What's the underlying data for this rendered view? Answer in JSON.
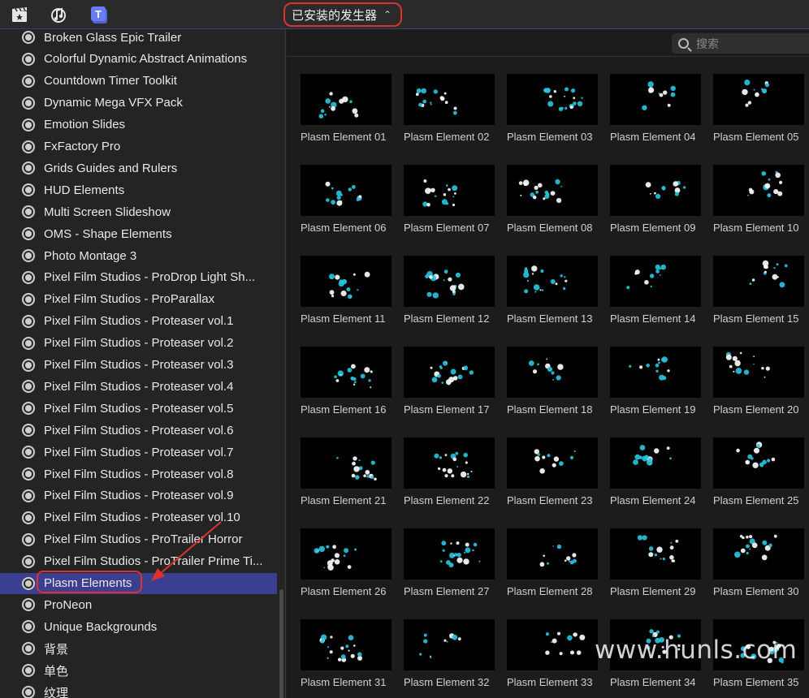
{
  "toolbar": {
    "icons": [
      "clapper-star-icon",
      "music-cam-icon",
      "titles-icon"
    ],
    "selector_label": "已安装的发生器",
    "selector_chevron": "⌃⌄"
  },
  "search": {
    "placeholder": "搜索"
  },
  "sidebar": {
    "items": [
      {
        "label": "Broken Glass Epic Trailer"
      },
      {
        "label": "Colorful Dynamic Abstract Animations"
      },
      {
        "label": "Countdown Timer Toolkit"
      },
      {
        "label": "Dynamic Mega VFX Pack"
      },
      {
        "label": "Emotion Slides"
      },
      {
        "label": "FxFactory Pro"
      },
      {
        "label": "Grids Guides and Rulers"
      },
      {
        "label": "HUD Elements"
      },
      {
        "label": "Multi Screen Slideshow"
      },
      {
        "label": "OMS - Shape Elements"
      },
      {
        "label": "Photo Montage 3"
      },
      {
        "label": "Pixel Film Studios - ProDrop Light Sh..."
      },
      {
        "label": "Pixel Film Studios - ProParallax"
      },
      {
        "label": "Pixel Film Studios - Proteaser vol.1"
      },
      {
        "label": "Pixel Film Studios - Proteaser vol.2"
      },
      {
        "label": "Pixel Film Studios - Proteaser vol.3"
      },
      {
        "label": "Pixel Film Studios - Proteaser vol.4"
      },
      {
        "label": "Pixel Film Studios - Proteaser vol.5"
      },
      {
        "label": "Pixel Film Studios - Proteaser vol.6"
      },
      {
        "label": "Pixel Film Studios - Proteaser vol.7"
      },
      {
        "label": "Pixel Film Studios - Proteaser vol.8"
      },
      {
        "label": "Pixel Film Studios - Proteaser vol.9"
      },
      {
        "label": "Pixel Film Studios - Proteaser vol.10"
      },
      {
        "label": "Pixel Film Studios - ProTrailer Horror"
      },
      {
        "label": "Pixel Film Studios - ProTrailer Prime Ti..."
      },
      {
        "label": "Plasm Elements",
        "selected": true
      },
      {
        "label": "ProNeon"
      },
      {
        "label": "Unique Backgrounds"
      },
      {
        "label": "背景"
      },
      {
        "label": "单色"
      },
      {
        "label": "纹理"
      }
    ]
  },
  "grid": {
    "items": [
      "Plasm Element 01",
      "Plasm Element 02",
      "Plasm Element 03",
      "Plasm Element 04",
      "Plasm Element 05",
      "Plasm Element 06",
      "Plasm Element 07",
      "Plasm Element 08",
      "Plasm Element 09",
      "Plasm Element 10",
      "Plasm Element 11",
      "Plasm Element 12",
      "Plasm Element 13",
      "Plasm Element 14",
      "Plasm Element 15",
      "Plasm Element 16",
      "Plasm Element 17",
      "Plasm Element 18",
      "Plasm Element 19",
      "Plasm Element 20",
      "Plasm Element 21",
      "Plasm Element 22",
      "Plasm Element 23",
      "Plasm Element 24",
      "Plasm Element 25",
      "Plasm Element 26",
      "Plasm Element 27",
      "Plasm Element 28",
      "Plasm Element 29",
      "Plasm Element 30",
      "Plasm Element 31",
      "Plasm Element 32",
      "Plasm Element 33",
      "Plasm Element 34",
      "Plasm Element 35"
    ]
  },
  "watermark": "www.hunls.com",
  "colors": {
    "accent_red": "#e03131",
    "selection": "#3b3f8f",
    "plasma_cyan": "#27c7e0"
  }
}
